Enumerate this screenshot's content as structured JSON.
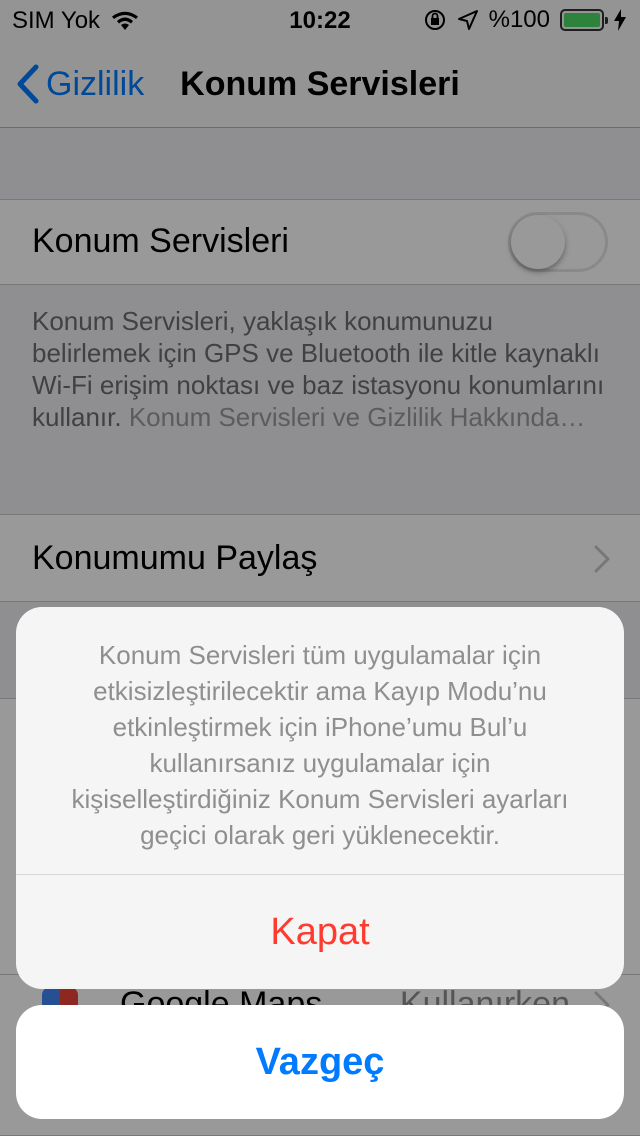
{
  "status_bar": {
    "carrier": "SIM Yok",
    "time": "10:22",
    "battery_percent": "%100",
    "battery_level": 1.0,
    "icons": [
      "wifi-icon",
      "orientation-lock-icon",
      "location-arrow-icon",
      "battery-icon",
      "charging-bolt-icon"
    ]
  },
  "nav": {
    "back_label": "Gizlilik",
    "title": "Konum Servisleri"
  },
  "settings": {
    "location_services_label": "Konum Servisleri",
    "location_services_on": false,
    "description": "Konum Servisleri, yaklaşık konumunuzu belirlemek için GPS ve Bluetooth ile kitle kaynaklı Wi-Fi erişim noktası ve baz istasyonu konumlarını kullanır.",
    "description_link": "Konum Servisleri ve Gizlilik Hakkında…",
    "share_location_label": "Konumumu Paylaş",
    "app_row": {
      "name": "Google Maps",
      "value": "Kullanırken"
    }
  },
  "action_sheet": {
    "message": "Konum Servisleri tüm uygulamalar için etkisizleştirilecektir ama Kayıp Modu’nu etkinleştirmek için iPhone’umu Bul’u kullanırsanız uygulamalar için kişiselleştirdiğiniz Konum Servisleri ayarları geçici olarak geri yüklenecektir.",
    "destructive_label": "Kapat",
    "cancel_label": "Vazgeç"
  },
  "colors": {
    "accent": "#007aff",
    "destructive": "#ff3b30",
    "battery": "#4cd964"
  }
}
